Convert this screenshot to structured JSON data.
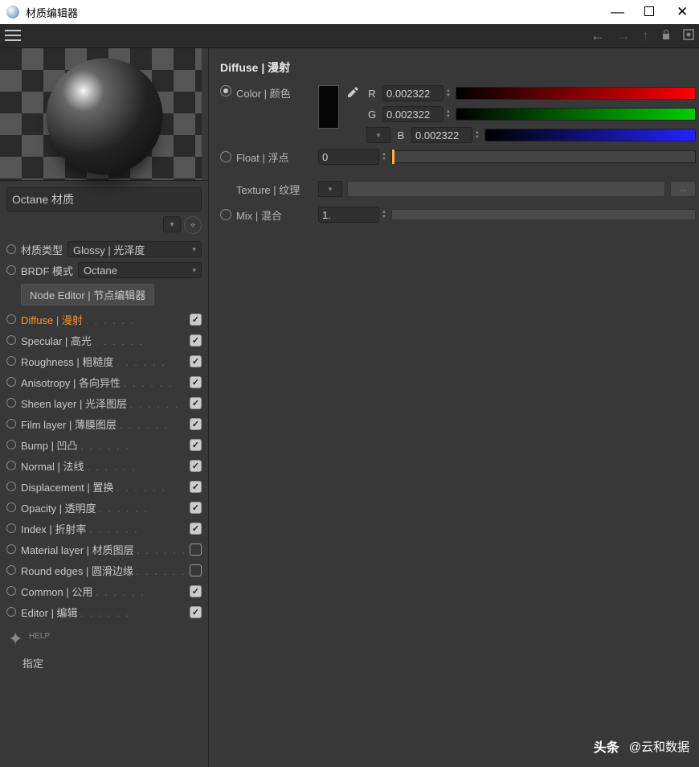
{
  "titlebar": {
    "title": "材质编辑器"
  },
  "material_name": "Octane 材质",
  "props": {
    "material_type_label": "材质类型",
    "material_type_value": "Glossy | 光泽度",
    "brdf_label": "BRDF 模式",
    "brdf_value": "Octane",
    "node_editor_btn": "Node Editor | 节点编辑器"
  },
  "channels": [
    {
      "label": "Diffuse | 漫射",
      "checked": true,
      "active": true
    },
    {
      "label": "Specular | 高光",
      "checked": true,
      "active": false
    },
    {
      "label": "Roughness | 粗糙度",
      "checked": true,
      "active": false
    },
    {
      "label": "Anisotropy | 各向异性",
      "checked": true,
      "active": false
    },
    {
      "label": "Sheen layer | 光泽图层",
      "checked": true,
      "active": false
    },
    {
      "label": "Film layer | 薄膜图层",
      "checked": true,
      "active": false
    },
    {
      "label": "Bump | 凹凸",
      "checked": true,
      "active": false
    },
    {
      "label": "Normal | 法线",
      "checked": true,
      "active": false
    },
    {
      "label": "Displacement | 置换",
      "checked": true,
      "active": false
    },
    {
      "label": "Opacity | 透明度",
      "checked": true,
      "active": false
    },
    {
      "label": "Index | 折射率",
      "checked": true,
      "active": false
    },
    {
      "label": "Material layer | 材质图层",
      "checked": false,
      "active": false
    },
    {
      "label": "Round edges | 圆滑边缘",
      "checked": false,
      "active": false
    },
    {
      "label": "Common | 公用",
      "checked": true,
      "active": false
    },
    {
      "label": "Editor | 编辑",
      "checked": true,
      "active": false
    }
  ],
  "help_label": "HELP",
  "assign_label": "指定",
  "panel": {
    "title": "Diffuse | 漫射",
    "color_label": "Color | 颜色",
    "r_label": "R",
    "r_value": "0.002322",
    "g_label": "G",
    "g_value": "0.002322",
    "b_label": "B",
    "b_value": "0.002322",
    "float_label": "Float | 浮点",
    "float_value": "0",
    "texture_label": "Texture | 纹理",
    "mix_label": "Mix | 混合",
    "mix_value": "1."
  },
  "watermark": {
    "brand": "头条",
    "author": "@云和数据"
  }
}
